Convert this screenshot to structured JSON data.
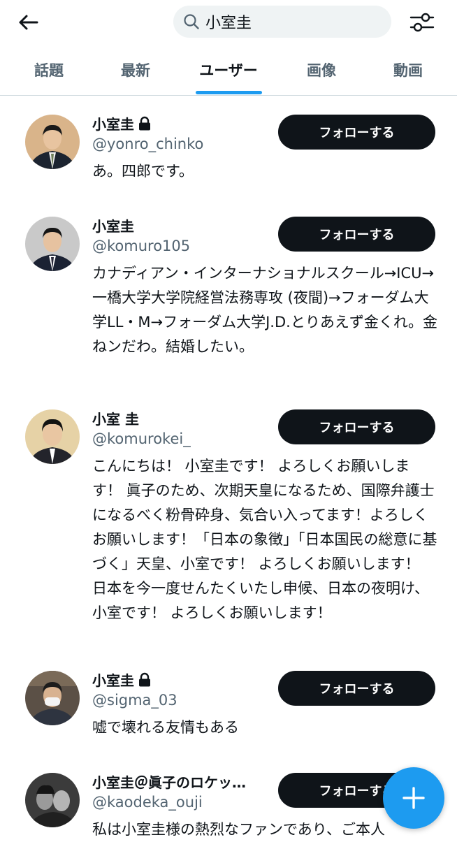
{
  "search": {
    "query": "小室圭"
  },
  "icons": {
    "back": "arrow-left-icon",
    "search": "search-icon",
    "filter": "sliders-icon",
    "lock": "lock-icon",
    "compose": "plus-icon"
  },
  "tabs": [
    {
      "label": "話題",
      "active": false
    },
    {
      "label": "最新",
      "active": false
    },
    {
      "label": "ユーザー",
      "active": true
    },
    {
      "label": "画像",
      "active": false
    },
    {
      "label": "動画",
      "active": false
    }
  ],
  "users": [
    {
      "name": "小室圭",
      "locked": true,
      "handle": "@yonro_chinko",
      "bio": "あ。四郎です。",
      "follow_label": "フォローする"
    },
    {
      "name": "小室圭",
      "locked": false,
      "handle": "@komuro105",
      "bio": "カナディアン・インターナショナルスクール→ICU→一橋大学大学院経営法務専攻 (夜間)→フォーダム大学LL・M→フォーダム大学J.D.とりあえず金くれ。金ねンだわ。結婚したい。",
      "follow_label": "フォローする"
    },
    {
      "name": "小室 圭",
      "locked": false,
      "handle": "@komurokei_",
      "bio": "こんにちは！ 小室圭です！ よろしくお願いします！ 眞子のため、次期天皇になるため、国際弁護士になるべく粉骨砕身、気合い入ってます！よろしくお願いします！「日本の象徴」「日本国民の総意に基づく」天皇、小室です！ よろしくお願いします！ 日本を今一度せんたくいたし申候、日本の夜明け、小室です！ よろしくお願いします！",
      "follow_label": "フォローする"
    },
    {
      "name": "小室圭",
      "locked": true,
      "handle": "@sigma_03",
      "bio": "嘘で壊れる友情もある",
      "follow_label": "フォローする"
    },
    {
      "name": "小室圭＠眞子のロケッ…",
      "locked": false,
      "handle": "@kaodeka_ouji",
      "bio": "私は小室圭様の熱烈なファンであり、ご本人",
      "follow_label": "フォローする"
    }
  ],
  "colors": {
    "accent": "#1d9bf0",
    "text": "#0f1419",
    "secondary": "#536471",
    "button": "#0f1419"
  }
}
